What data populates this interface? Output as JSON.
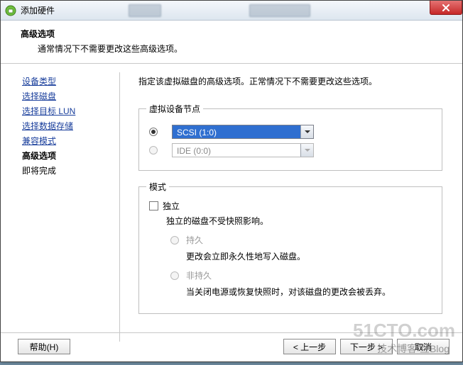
{
  "titlebar": {
    "title": "添加硬件"
  },
  "header": {
    "title": "高级选项",
    "subtitle": "通常情况下不需要更改这些高级选项。"
  },
  "sidebar": {
    "items": [
      {
        "label": "设备类型",
        "kind": "link"
      },
      {
        "label": "选择磁盘",
        "kind": "link"
      },
      {
        "label": "选择目标 LUN",
        "kind": "link"
      },
      {
        "label": "选择数据存储",
        "kind": "link"
      },
      {
        "label": "兼容模式",
        "kind": "link"
      },
      {
        "label": "高级选项",
        "kind": "current"
      },
      {
        "label": "即将完成",
        "kind": "plain"
      }
    ]
  },
  "main": {
    "instruction": "指定该虚拟磁盘的高级选项。正常情况下不需要更改这些选项。",
    "node_group": {
      "legend": "虚拟设备节点",
      "scsi": {
        "value": "SCSI (1:0)",
        "selected": true
      },
      "ide": {
        "value": "IDE (0:0)",
        "selected": false
      }
    },
    "mode_group": {
      "legend": "模式",
      "independent_label": "独立",
      "independent_desc": "独立的磁盘不受快照影响。",
      "persistent": {
        "label": "持久",
        "desc": "更改会立即永久性地写入磁盘。"
      },
      "nonpersistent": {
        "label": "非持久",
        "desc": "当关闭电源或恢复快照时，对该磁盘的更改会被丢弃。"
      }
    }
  },
  "footer": {
    "help": "帮助(H)",
    "back": "< 上一步",
    "next": "下一步 >",
    "cancel": "取消"
  },
  "watermark": {
    "big": "51CTO.com",
    "small": "技术博客  互Blog"
  }
}
